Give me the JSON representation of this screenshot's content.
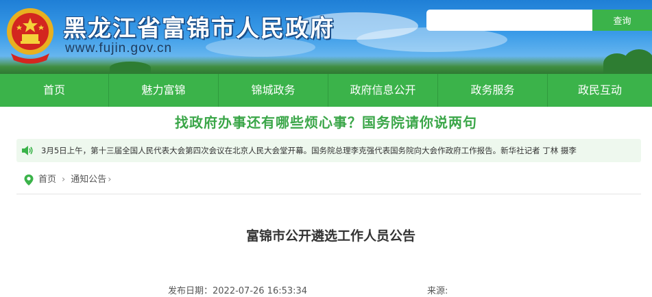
{
  "header": {
    "site_title": "黑龙江省富锦市人民政府",
    "site_url": "www.fujin.gov.cn",
    "emblem_icon": "national-emblem-icon",
    "search": {
      "value": "",
      "placeholder": "",
      "button_label": "查询"
    }
  },
  "nav": {
    "items": [
      {
        "label": "首页"
      },
      {
        "label": "魅力富锦"
      },
      {
        "label": "锦城政务"
      },
      {
        "label": "政府信息公开"
      },
      {
        "label": "政务服务"
      },
      {
        "label": "政民互动"
      }
    ]
  },
  "headline": "找政府办事还有哪些烦心事？国务院请你说两句",
  "notice": {
    "icon": "speaker-icon",
    "text": "3月5日上午，第十三届全国人民代表大会第四次会议在北京人民大会堂开幕。国务院总理李克强代表国务院向大会作政府工作报告。新华社记者 丁林 摄李"
  },
  "breadcrumb": {
    "icon": "location-pin-icon",
    "home": "首页",
    "separator": "›",
    "current": "通知公告",
    "trailing": "›"
  },
  "article": {
    "title": "富锦市公开遴选工作人员公告",
    "date_label": "发布日期：2022-07-26 16:53:34",
    "source_label": "来源:"
  },
  "colors": {
    "brand_green": "#3bb34a",
    "headline_green": "#3aa648",
    "notice_bg": "#eef8ee",
    "sky_blue": "#3a9be8"
  }
}
